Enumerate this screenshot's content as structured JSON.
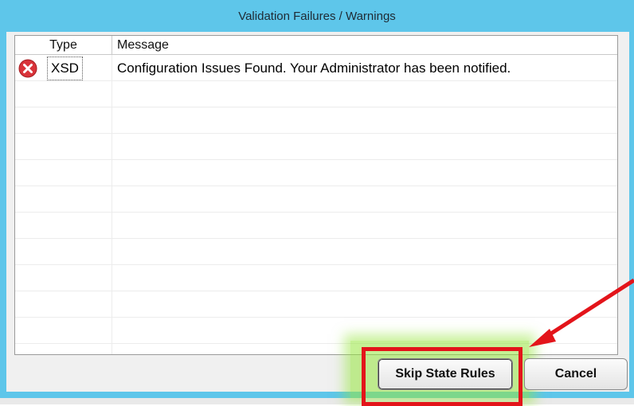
{
  "dialog": {
    "title": "Validation Failures / Warnings"
  },
  "grid": {
    "columns": [
      "Type",
      "Message"
    ],
    "rows": [
      {
        "icon": "error-icon",
        "type": "XSD",
        "message": "Configuration Issues Found. Your Administrator has been notified."
      }
    ],
    "empty_rows": 10
  },
  "buttons": {
    "skip_label": "Skip State Rules",
    "cancel_label": "Cancel"
  },
  "annotation": {
    "highlight_color": "#e3141a",
    "glow_color": "#96e63c",
    "arrow_color": "#e3141a"
  },
  "colors": {
    "titlebar": "#5ec6ea",
    "error_icon": "#d9343a"
  }
}
